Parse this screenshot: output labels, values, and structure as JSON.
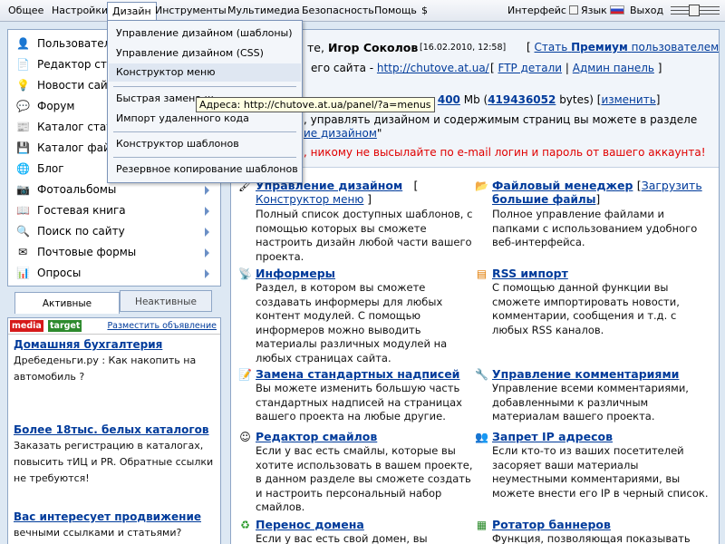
{
  "menubar": {
    "items": [
      "Общее",
      "Настройки",
      "Дизайн",
      "Инструменты",
      "Мультимедиа",
      "Безопасность",
      "Помощь",
      "$"
    ],
    "active": "Дизайн",
    "interface_label": "Интерфейс",
    "language_label": "Язык",
    "exit_label": "Выход"
  },
  "design_menu": {
    "items": [
      "Управление дизайном (шаблоны)",
      "Управление дизайном (CSS)",
      "Конструктор меню",
      "Быстрая замена ш",
      "Импорт удаленного кода",
      "Конструктор шаблонов",
      "Резервное копирование шаблонов"
    ],
    "highlighted": "Конструктор меню"
  },
  "tooltip": "Адреса: http://chutove.at.ua/panel/?a=menus",
  "sidebar": {
    "items": [
      {
        "label": "Пользовател",
        "icon": "user-icon",
        "submenu": false
      },
      {
        "label": "Редактор стр",
        "icon": "page-editor-icon",
        "submenu": false
      },
      {
        "label": "Новости сайт",
        "icon": "bulb-icon",
        "submenu": false
      },
      {
        "label": "Форум",
        "icon": "forum-icon",
        "submenu": false
      },
      {
        "label": "Каталог стате",
        "icon": "articles-icon",
        "submenu": false
      },
      {
        "label": "Каталог файл",
        "icon": "files-icon",
        "submenu": false
      },
      {
        "label": "Блог",
        "icon": "blog-icon",
        "submenu": false
      },
      {
        "label": "Фотоальбомы",
        "icon": "camera-icon",
        "submenu": true
      },
      {
        "label": "Гостевая книга",
        "icon": "guestbook-icon",
        "submenu": true
      },
      {
        "label": "Поиск по сайту",
        "icon": "search-icon",
        "submenu": true
      },
      {
        "label": "Почтовые формы",
        "icon": "mail-icon",
        "submenu": true
      },
      {
        "label": "Опросы",
        "icon": "poll-icon",
        "submenu": true
      }
    ]
  },
  "module_tabs": {
    "active": "Активные",
    "inactive": "Неактивные"
  },
  "ads": {
    "brand_a": "media",
    "brand_b": "target",
    "place_link": "Разместить объявление",
    "items": [
      {
        "title": "Домашняя бухгалтерия",
        "desc": "Дребеденьги.ру : Как накопить на автомобиль ?"
      },
      {
        "title": "Более 18тыс. белых каталогов",
        "desc": "Заказать регистрацию в каталогах, повысить тИЦ и PR. Обратные ссылки не требуются!"
      },
      {
        "title": "Вас интересует продвижение",
        "desc": "вечными ссылками и статьями?"
      }
    ]
  },
  "info": {
    "greeting_tail": "те,",
    "user_name": "Игор Соколов",
    "date": "[16.02.2010, 12:58]",
    "premium_open": "[",
    "premium_link": "Стать",
    "premium_bold": "Премиум",
    "premium_tail": "пользователем",
    "premium_close": "]",
    "site_label": "его сайта -",
    "site_url": "http://chutove.at.ua/",
    "ftp_link": "FTP детали",
    "admin_link": "Админ панель",
    "space_prefix": "ство",
    "space_mb": "400",
    "space_mb_unit": "Mb (",
    "space_bytes": "419436052",
    "space_bytes_unit": "bytes) [",
    "space_change": "изменить",
    "space_close": "]",
    "manage_text": ", управлять дизайном и содержимым страниц вы можете в разделе",
    "manage_link": "ие дизайном",
    "manage_close": "\"",
    "warning": ", никому не высылайте по e-mail логин и пароль от вашего аккаунта!"
  },
  "features": [
    {
      "title": "Управление дизайном",
      "bracket": "[",
      "link": "Конструктор меню",
      "close": "]",
      "icon": "design-icon",
      "desc": "Полный список доступных шаблонов, с помощью которых вы сможете настроить дизайн любой части вашего проекта."
    },
    {
      "title": "Файловый менеджер",
      "bracket": "[",
      "link": "Загрузить большие файлы",
      "close": "]",
      "icon": "folder-icon",
      "desc": "Полное управление файлами и папками с использованием удобного веб-интерфейса."
    },
    {
      "title": "Информеры",
      "icon": "informer-icon",
      "desc": "Раздел, в котором вы сможете создавать информеры для любых контент модулей. С помощью информеров можно выводить материалы различных модулей на любых страницах сайта."
    },
    {
      "title": "RSS импорт",
      "icon": "rss-icon",
      "desc": "С помощью данной функции вы сможете импортировать новости, комментарии, сообщения и т.д. с любых RSS каналов."
    },
    {
      "title": "Замена стандартных надписей",
      "icon": "labels-icon",
      "desc": "Вы можете изменить большую часть стандартных надписей на страницах вашего проекта на любые другие."
    },
    {
      "title": "Управление комментариями",
      "icon": "comments-icon",
      "desc": "Управление всеми комментариями, добавленными к различным материалам вашего проекта."
    },
    {
      "title": "Редактор смайлов",
      "icon": "smiley-icon",
      "desc": "Если у вас есть смайлы, которые вы хотите использовать в вашем проекте, в данном разделе вы сможете создать и настроить персональный набор смайлов."
    },
    {
      "title": "Запрет IP адресов",
      "icon": "ip-ban-icon",
      "desc": "Если кто-то из ваших посетителей засоряет ваши материалы неуместными комментариями, вы можете внести его IP в черный список."
    },
    {
      "title": "Перенос домена",
      "icon": "domain-icon",
      "desc": "Если у вас есть свой домен, вы можете"
    },
    {
      "title": "Ротатор баннеров",
      "icon": "banner-icon",
      "desc": "Функция, позволяющая показывать"
    }
  ]
}
